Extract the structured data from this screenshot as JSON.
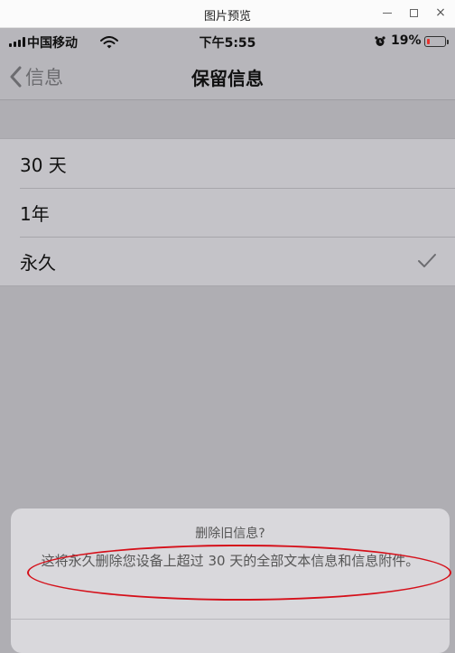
{
  "window": {
    "title": "图片预览",
    "controls": {
      "minimize": "minimize-icon",
      "maximize": "maximize-icon",
      "close": "×"
    }
  },
  "status_bar": {
    "carrier": "中国移动",
    "time": "下午5:55",
    "battery_percent": "19%",
    "battery_level": 0.19,
    "battery_color": "#e8322d",
    "icons": [
      "signal-icon",
      "wifi-icon",
      "alarm-icon",
      "battery-icon"
    ]
  },
  "nav": {
    "back_label": "信息",
    "title": "保留信息"
  },
  "options": [
    {
      "label": "30 天",
      "selected": false
    },
    {
      "label": "1年",
      "selected": false
    },
    {
      "label": "永久",
      "selected": true
    }
  ],
  "action_sheet": {
    "title": "删除旧信息?",
    "message": "这将永久删除您设备上超过 30 天的全部文本信息和信息附件。"
  },
  "colors": {
    "background": "#afaeb3",
    "list_background": "#c4c3c8",
    "annotation": "#d5101a"
  }
}
